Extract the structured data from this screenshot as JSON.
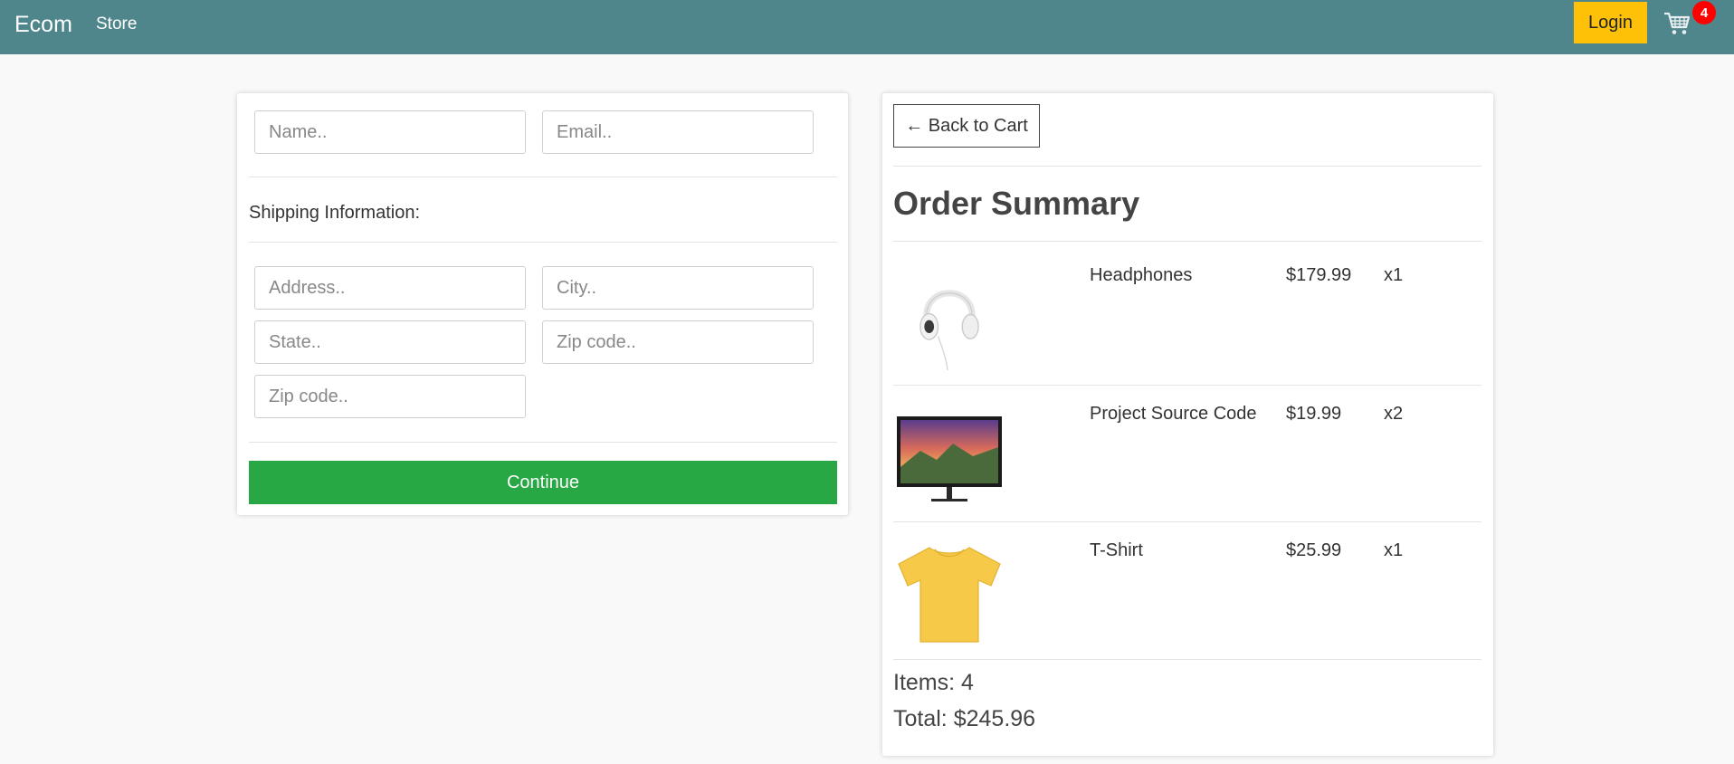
{
  "navbar": {
    "brand": "Ecom",
    "store_link": "Store",
    "login_label": "Login",
    "cart_count": "4",
    "cart_icon": "cart-icon"
  },
  "checkout_form": {
    "name_placeholder": "Name..",
    "email_placeholder": "Email..",
    "shipping_heading": "Shipping Information:",
    "address_placeholder": "Address..",
    "city_placeholder": "City..",
    "state_placeholder": "State..",
    "zip_placeholder": "Zip code..",
    "zip2_placeholder": "Zip code..",
    "continue_label": "Continue"
  },
  "summary": {
    "back_label": "← Back to Cart",
    "title": "Order Summary",
    "items": [
      {
        "name": "Headphones",
        "price": "$179.99",
        "qty": "x1",
        "image": "headphones-image"
      },
      {
        "name": "Project Source Code",
        "price": "$19.99",
        "qty": "x2",
        "image": "monitor-image"
      },
      {
        "name": "T-Shirt",
        "price": "$25.99",
        "qty": "x1",
        "image": "tshirt-image"
      }
    ],
    "items_total": "Items: 4",
    "grand_total": "Total: $245.96"
  },
  "colors": {
    "navbar": "#4f868c",
    "login": "#ffc107",
    "continue": "#28a745",
    "badge": "#ff0000"
  }
}
